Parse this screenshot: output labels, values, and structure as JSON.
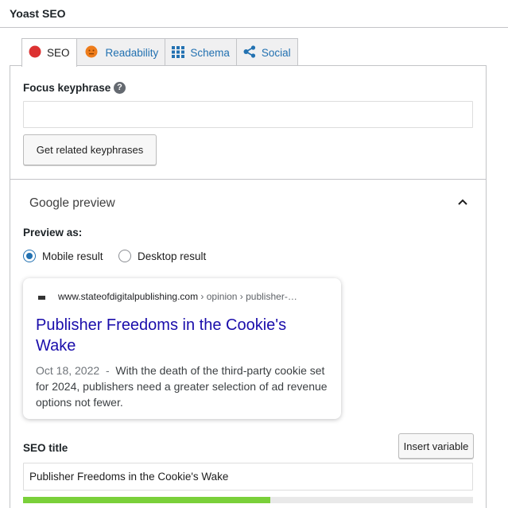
{
  "header": {
    "title": "Yoast SEO"
  },
  "tabs": [
    {
      "label": "SEO",
      "icon": "red-dot-icon",
      "active": true
    },
    {
      "label": "Readability",
      "icon": "orange-face-icon",
      "active": false
    },
    {
      "label": "Schema",
      "icon": "grid-icon",
      "active": false
    },
    {
      "label": "Social",
      "icon": "share-icon",
      "active": false
    }
  ],
  "focus": {
    "label": "Focus keyphrase",
    "help": "?",
    "value": "",
    "related_button": "Get related keyphrases"
  },
  "google_preview": {
    "title": "Google preview",
    "preview_as_label": "Preview as:",
    "options": [
      "Mobile result",
      "Desktop result"
    ],
    "selected": "Mobile result",
    "serp": {
      "domain": "www.stateofdigitalpublishing.com",
      "breadcrumbs": " › opinion › publisher-…",
      "title": "Publisher Freedoms in the Cookie's Wake",
      "date": "Oct 18, 2022",
      "separator": "  -  ",
      "description": "With the death of the third-party cookie set for 2024, publishers need a greater selection of ad revenue options not fewer."
    }
  },
  "seo_title": {
    "label": "SEO title",
    "insert_variable": "Insert variable",
    "value": "Publisher Freedoms in the Cookie's Wake",
    "progress": 0.55
  },
  "colors": {
    "accent": "#2271b1",
    "serp_link": "#1a0dab",
    "progress_good": "#7ad03a",
    "seo_status": "#dc3232",
    "readability_status": "#ee7c1b"
  }
}
